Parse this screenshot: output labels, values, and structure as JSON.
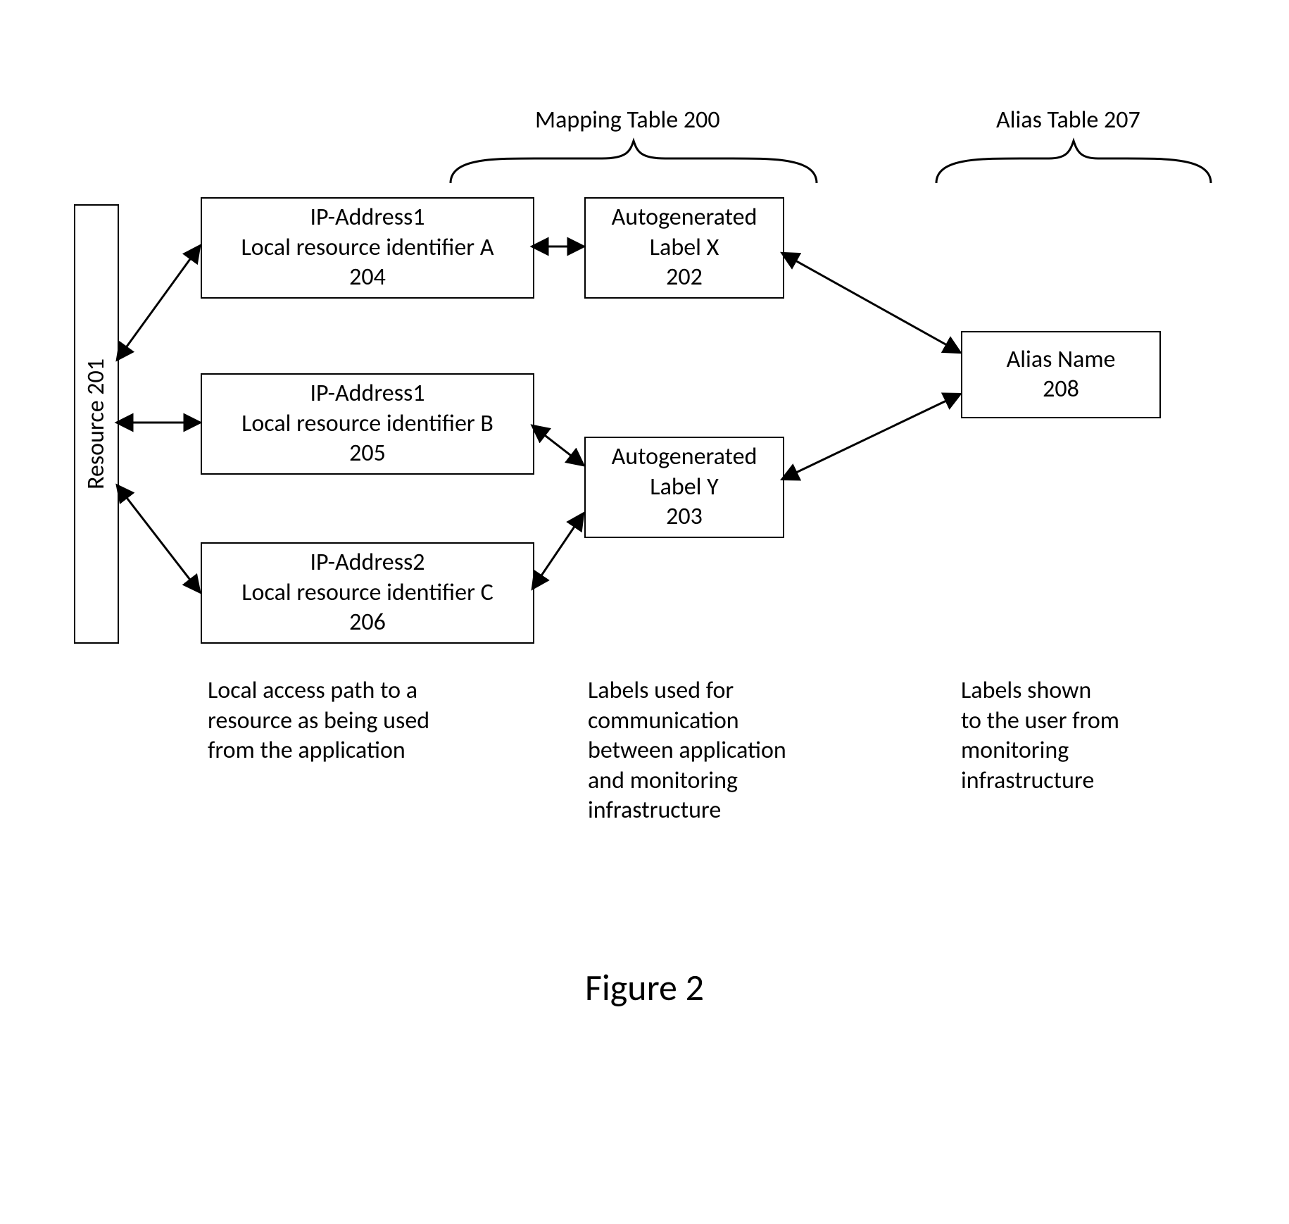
{
  "headers": {
    "mapping_table": "Mapping Table 200",
    "alias_table": "Alias Table 207"
  },
  "resource": {
    "label": "Resource 201"
  },
  "local_paths": {
    "a": "IP-Address1\nLocal resource identifier A\n204",
    "b": "IP-Address1\nLocal resource identifier B\n205",
    "c": "IP-Address2\nLocal resource identifier C\n206"
  },
  "autolabels": {
    "x": "Autogenerated\nLabel X\n202",
    "y": "Autogenerated\nLabel Y\n203"
  },
  "alias": {
    "name": "Alias Name\n208"
  },
  "captions": {
    "local": "Local access path to  a\nresource as being used\nfrom the application",
    "labels": "Labels used for\ncommunication\nbetween application\nand monitoring\ninfrastructure",
    "alias": "Labels shown\nto the user from\nmonitoring\ninfrastructure"
  },
  "figure_caption": "Figure 2"
}
